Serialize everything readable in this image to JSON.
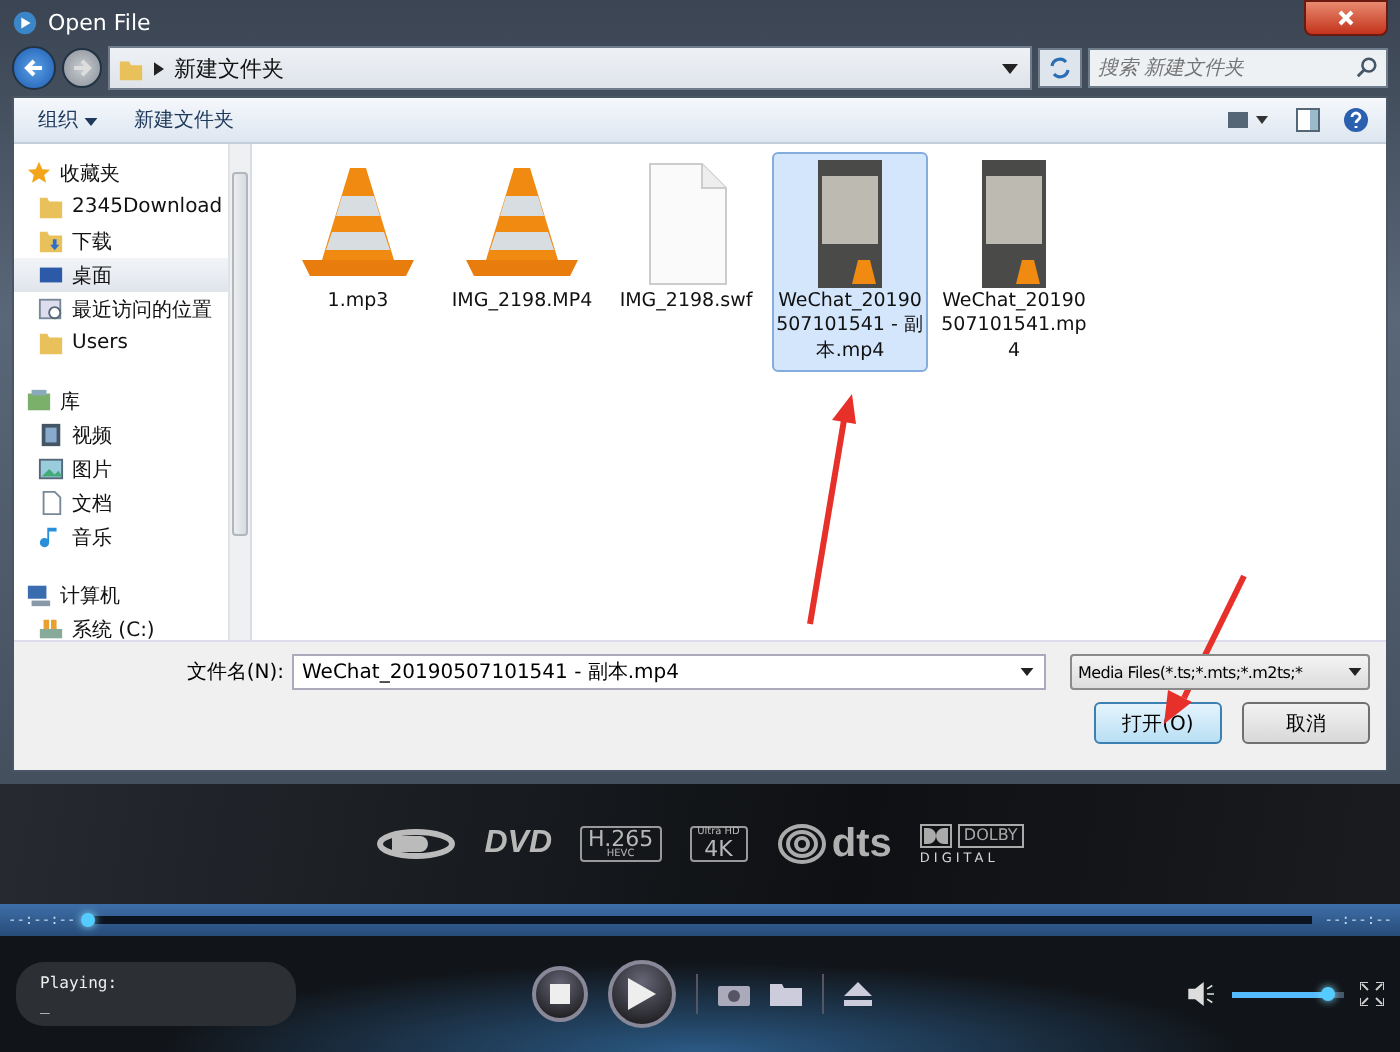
{
  "window": {
    "title": "Open File"
  },
  "address": {
    "path": "新建文件夹",
    "search_placeholder": "搜索 新建文件夹"
  },
  "toolbar": {
    "organize": "组织",
    "new_folder": "新建文件夹"
  },
  "sidebar": {
    "groups": [
      {
        "label": "收藏夹",
        "kind": "star",
        "children": [
          {
            "label": "2345Download",
            "kind": "folder",
            "selected": false
          },
          {
            "label": "下载",
            "kind": "download",
            "selected": false
          },
          {
            "label": "桌面",
            "kind": "desktop",
            "selected": true
          },
          {
            "label": "最近访问的位置",
            "kind": "recent",
            "selected": false
          },
          {
            "label": "Users",
            "kind": "folder",
            "selected": false
          }
        ]
      },
      {
        "label": "库",
        "kind": "library",
        "children": [
          {
            "label": "视频",
            "kind": "video",
            "selected": false
          },
          {
            "label": "图片",
            "kind": "picture",
            "selected": false
          },
          {
            "label": "文档",
            "kind": "document",
            "selected": false
          },
          {
            "label": "音乐",
            "kind": "music",
            "selected": false
          }
        ]
      },
      {
        "label": "计算机",
        "kind": "computer",
        "children": [
          {
            "label": "系统 (C:)",
            "kind": "drive",
            "selected": false
          }
        ]
      }
    ]
  },
  "files": [
    {
      "name": "1.mp3",
      "kind": "vlc",
      "selected": false
    },
    {
      "name": "IMG_2198.MP4",
      "kind": "vlc",
      "selected": false
    },
    {
      "name": "IMG_2198.swf",
      "kind": "blank",
      "selected": false
    },
    {
      "name": "WeChat_20190507101541 - 副本.mp4",
      "kind": "video",
      "selected": true
    },
    {
      "name": "WeChat_20190507101541.mp4",
      "kind": "video",
      "selected": false
    }
  ],
  "filename": {
    "label": "文件名(N):",
    "value": "WeChat_20190507101541 - 副本.mp4"
  },
  "filter": {
    "value": "Media Files(*.ts;*.mts;*.m2ts;*"
  },
  "buttons": [
    {
      "label": "打开(O)",
      "kind": "primary"
    },
    {
      "label": "取消",
      "kind": "cancel"
    }
  ],
  "player": {
    "logos": [
      {
        "kind": "bluray"
      },
      {
        "kind": "dvd",
        "text": "DVD"
      },
      {
        "kind": "hevc",
        "text": "H.265",
        "sub": "HEVC"
      },
      {
        "kind": "uhd",
        "text": "4K",
        "sub": "Ultra HD"
      },
      {
        "kind": "dts",
        "text": "dts"
      },
      {
        "kind": "dolby",
        "text": "DOLBY",
        "sub": "DIGITAL"
      }
    ],
    "time_elapsed": "--:--:--",
    "time_total": "--:--:--",
    "seek": {
      "level": 0.0
    },
    "status": "Playing:",
    "status_detail": "_",
    "volume": {
      "level": 0.85
    }
  }
}
